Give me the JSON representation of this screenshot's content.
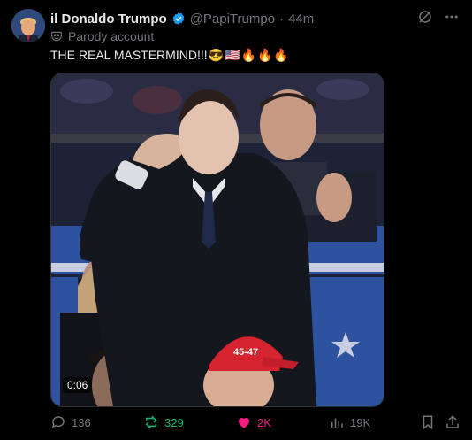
{
  "author": {
    "display_name": "il Donaldo Trumpo",
    "handle": "@PapiTrumpo",
    "separator": "·",
    "time_ago": "44m",
    "parody_label": "Parody account",
    "verified_color": "#1d9bf0"
  },
  "tweet": {
    "text": "THE REAL MASTERMIND!!!",
    "emojis": [
      "😎",
      "🇺🇸",
      "🔥",
      "🔥",
      "🔥"
    ]
  },
  "media": {
    "type": "video",
    "duration": "0:06",
    "sign_text": "45-47"
  },
  "actions": {
    "replies": "136",
    "retweets": "329",
    "likes": "2K",
    "views": "19K"
  },
  "colors": {
    "retweet_active": "#00ba7c",
    "like_active": "#f91880",
    "muted": "#71767b"
  },
  "icons": [
    "grok-icon",
    "more-icon",
    "parody-mask-icon",
    "reply-icon",
    "retweet-icon",
    "like-icon",
    "views-icon",
    "bookmark-icon",
    "share-icon"
  ]
}
